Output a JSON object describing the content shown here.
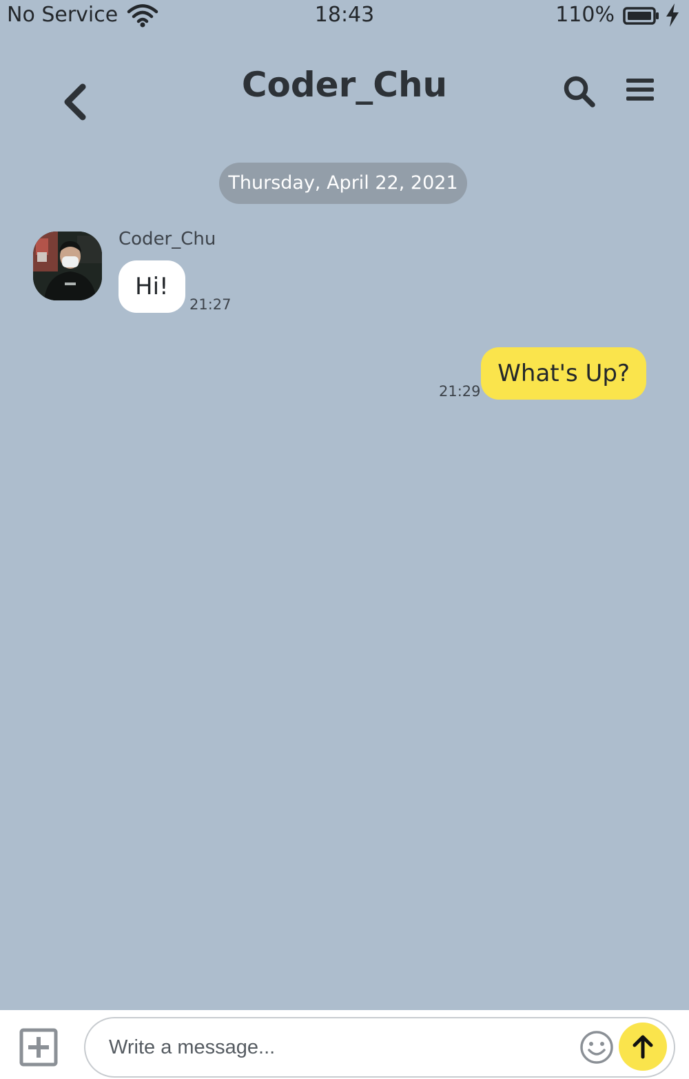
{
  "status_bar": {
    "carrier": "No Service",
    "time": "18:43",
    "battery_percent": "110%"
  },
  "header": {
    "title": "Coder_Chu",
    "icons": [
      "back-chevron-icon",
      "search-icon",
      "hamburger-menu-icon"
    ]
  },
  "chat": {
    "date_label": "Thursday, April 22, 2021",
    "messages": [
      {
        "direction": "incoming",
        "sender": "Coder_Chu",
        "text": "Hi!",
        "time": "21:27"
      },
      {
        "direction": "outgoing",
        "text": "What's Up?",
        "time": "21:29"
      }
    ]
  },
  "composer": {
    "placeholder": "Write a message...",
    "value": "",
    "icons": [
      "plus-square-icon",
      "smile-icon",
      "arrow-up-icon"
    ]
  },
  "colors": {
    "background": "#adbdcd",
    "date_pill": "#939ea9",
    "outgoing_bubble": "#fae44c",
    "incoming_bubble": "#ffffff",
    "send_button": "#fae44c"
  }
}
